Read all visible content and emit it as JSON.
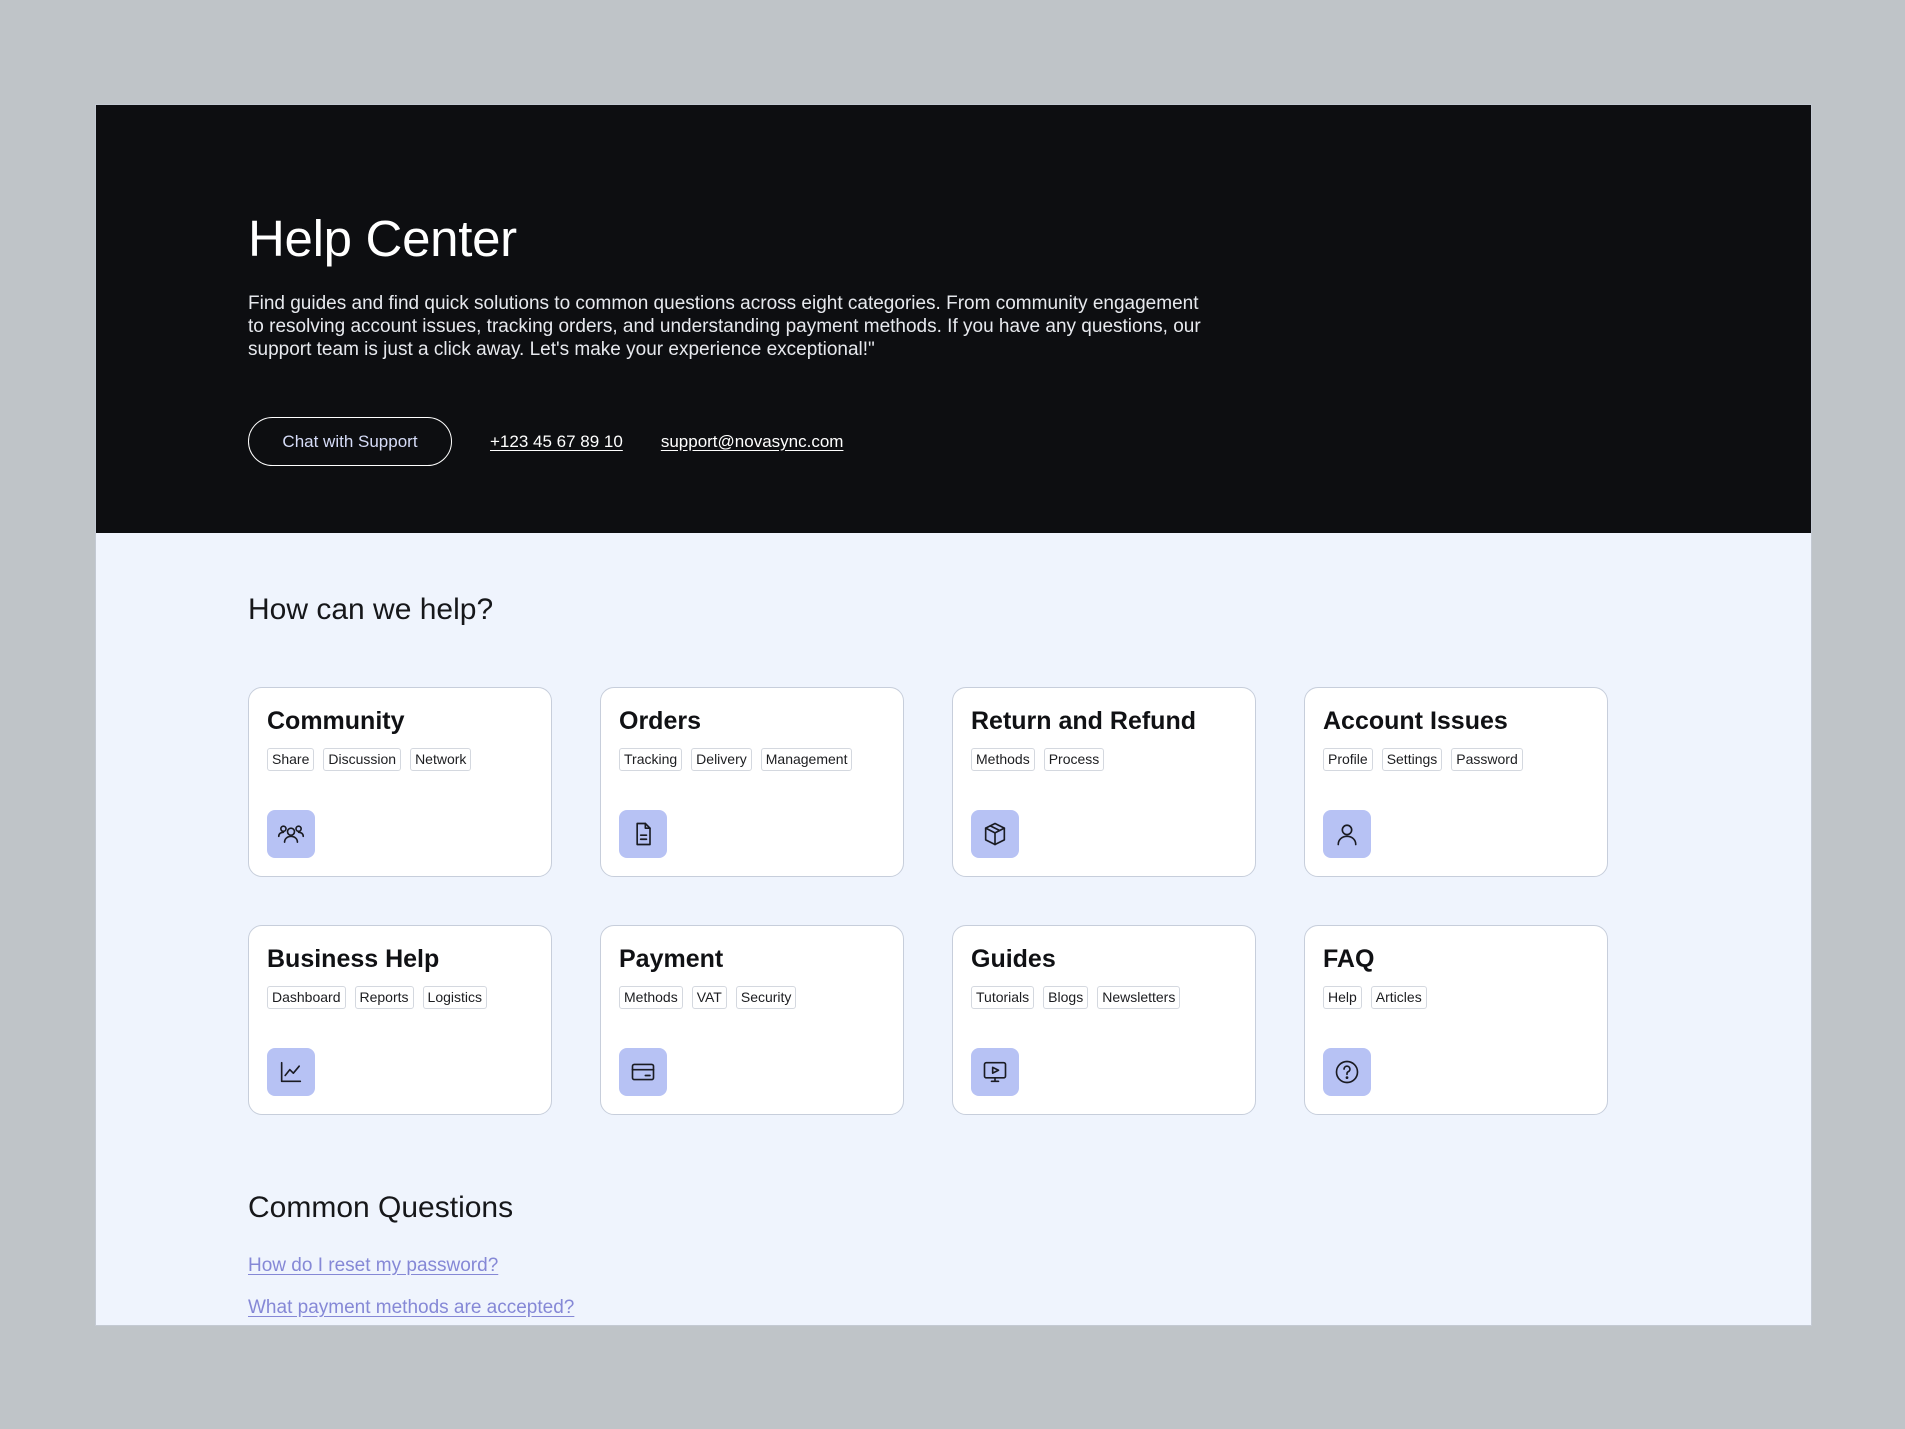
{
  "hero": {
    "title": "Help Center",
    "description": "Find guides and find quick solutions to common questions across eight categories. From community engagement to resolving account issues, tracking orders, and understanding payment methods. If you have any questions, our support team is just a click away. Let's make your experience exceptional!\"",
    "chat_button": "Chat with Support",
    "phone": "+123 45 67 89 10",
    "email": "support@novasync.com"
  },
  "help": {
    "title": "How can we help?",
    "cards": [
      {
        "title": "Community",
        "tags": [
          "Share",
          "Discussion",
          "Network"
        ],
        "icon": "users-icon"
      },
      {
        "title": "Orders",
        "tags": [
          "Tracking",
          "Delivery",
          "Management"
        ],
        "icon": "document-icon"
      },
      {
        "title": "Return and Refund",
        "tags": [
          "Methods",
          "Process"
        ],
        "icon": "box-icon"
      },
      {
        "title": "Account Issues",
        "tags": [
          "Profile",
          "Settings",
          "Password"
        ],
        "icon": "user-icon"
      },
      {
        "title": "Business Help",
        "tags": [
          "Dashboard",
          "Reports",
          "Logistics"
        ],
        "icon": "chart-line-icon"
      },
      {
        "title": "Payment",
        "tags": [
          "Methods",
          "VAT",
          "Security"
        ],
        "icon": "credit-card-icon"
      },
      {
        "title": "Guides",
        "tags": [
          "Tutorials",
          "Blogs",
          "Newsletters"
        ],
        "icon": "video-monitor-icon"
      },
      {
        "title": "FAQ",
        "tags": [
          "Help",
          "Articles"
        ],
        "icon": "question-circle-icon"
      }
    ]
  },
  "common": {
    "title": "Common Questions",
    "questions": [
      "How do I reset my password?",
      "What payment methods are accepted?"
    ]
  },
  "colors": {
    "hero_bg": "#0d0e11",
    "page_bg": "#eff4fd",
    "icon_tile": "#b7c2f4",
    "link": "#8588d6"
  }
}
